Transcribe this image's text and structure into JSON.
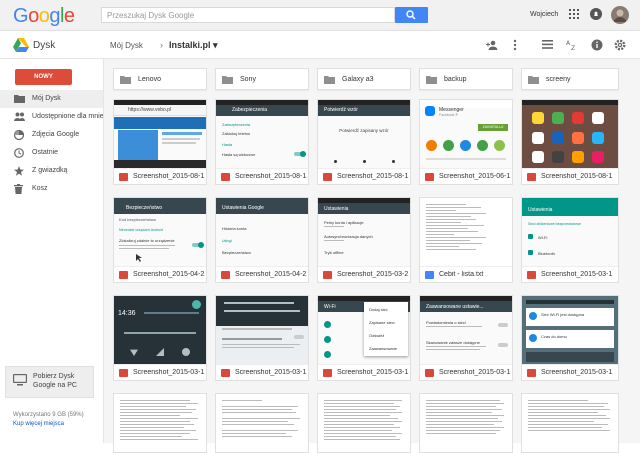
{
  "header": {
    "logo_letters": [
      "G",
      "o",
      "o",
      "g",
      "l",
      "e"
    ],
    "search_placeholder": "Przeszukaj Dysk Google",
    "user_name": "Wojciech"
  },
  "subheader": {
    "app_name": "Dysk",
    "breadcrumb_root": "Mój Dysk",
    "breadcrumb_sep": "›",
    "breadcrumb_current": "Instalki.pl ▾"
  },
  "sidebar": {
    "new_button": "NOWY",
    "items": [
      {
        "label": "Mój Dysk",
        "icon": "folder-icon"
      },
      {
        "label": "Udostępnione dla mnie",
        "icon": "people-icon"
      },
      {
        "label": "Zdjęcia Google",
        "icon": "photos-icon"
      },
      {
        "label": "Ostatnie",
        "icon": "clock-icon"
      },
      {
        "label": "Z gwiazdką",
        "icon": "star-icon"
      },
      {
        "label": "Kosz",
        "icon": "trash-icon"
      }
    ],
    "promo": "Pobierz Dysk Google na PC",
    "quota": "Wykorzystano 9 GB (59%)",
    "quota_link": "Kup więcej miejsca"
  },
  "folders": [
    "Lenovo",
    "Sony",
    "Galaxy a3",
    "backup",
    "screeny"
  ],
  "files": [
    {
      "name": "Screenshot_2015-08-1...",
      "type": "image"
    },
    {
      "name": "Screenshot_2015-08-1...",
      "type": "image"
    },
    {
      "name": "Screenshot_2015-08-1...",
      "type": "image"
    },
    {
      "name": "Screenshot_2015-06-1...",
      "type": "image"
    },
    {
      "name": "Screenshot_2015-08-1...",
      "type": "image"
    },
    {
      "name": "Screenshot_2015-04-2...",
      "type": "image"
    },
    {
      "name": "Screenshot_2015-04-2...",
      "type": "image"
    },
    {
      "name": "Screenshot_2015-03-2...",
      "type": "image"
    },
    {
      "name": "Cebit - lista.txt",
      "type": "text"
    },
    {
      "name": "Screenshot_2015-03-1...",
      "type": "image"
    },
    {
      "name": "Screenshot_2015-03-1...",
      "type": "image"
    },
    {
      "name": "Screenshot_2015-03-1...",
      "type": "image"
    },
    {
      "name": "Screenshot_2015-03-1...",
      "type": "image"
    },
    {
      "name": "Screenshot_2015-03-1...",
      "type": "image"
    },
    {
      "name": "Screenshot_2015-03-1...",
      "type": "image"
    }
  ],
  "thumbs": {
    "t1_url": "https://www.vebo.pl",
    "t2_title": "Zabezpieczenia",
    "t2_l1": "Zabezpieczenia",
    "t2_l2": "Zablokuj telefon",
    "t2_l3": "Hasła",
    "t2_l4": "Hasła są widoczne",
    "t3_title": "Potwierdź wzór",
    "t3_body": "Potwierdź zapisany wzór",
    "t4_app": "Messenger",
    "t4_dev": "Facebook ®",
    "t4_btn": "ZAINSTALUJ",
    "t6_title": "Bezpieczeństwo",
    "t6_l1": "Kod bezpieczeństwa",
    "t6_l2": "Menedżer urządzeń Android",
    "t6_l3": "Zlokalizuj zdalnie to urządzenie",
    "t7_title": "Ustawienia Google",
    "t7_l1": "Historia konta",
    "t7_l2": "Usługi",
    "t7_l3": "Bezpieczeństwo",
    "t8_title": "Ustawienia",
    "t8_l1": "Pełny konta i aplikacje",
    "t8_l2": "Autosynchronizacja danych",
    "t8_l3": "Tryb offline",
    "t10_title": "Ustawienia",
    "t10_l1": "Wi-Fi",
    "t10_l2": "Bluetooth",
    "t10_l3": "Sieci zbliżeniowe bezprzewodowe",
    "t11_time": "14:36",
    "t13_title": "Wi-Fi",
    "t13_m1": "Dodaj sieć",
    "t13_m2": "Zapisane sieci",
    "t13_m3": "Odśwież",
    "t13_m4": "Zaawansowane",
    "t14_title": "Zaawansowane ustawie...",
    "t14_l1": "Powiadomienia o sieci",
    "t14_l2": "Skanowanie zawsze dostępne",
    "t15_l1": "Sieć Wi-Fi jest dostępna",
    "t15_l2": "Czas do domu"
  }
}
